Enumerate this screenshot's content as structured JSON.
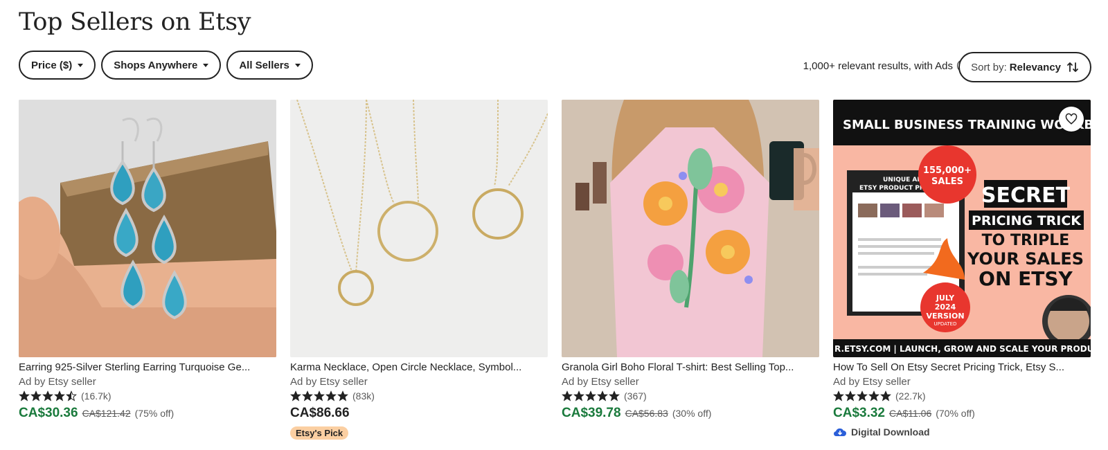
{
  "page": {
    "title": "Top Sellers on Etsy"
  },
  "filters": [
    {
      "label": "Price ($)"
    },
    {
      "label": "Shops Anywhere"
    },
    {
      "label": "All Sellers"
    }
  ],
  "results": {
    "text": "1,000+ relevant results, with Ads",
    "help_icon": "?"
  },
  "sort": {
    "label": "Sort by:",
    "value": "Relevancy"
  },
  "colors": {
    "sale_price": "#1a7a3c",
    "etsys_pick_badge": "#fbcfa2",
    "text": "#222222",
    "muted": "#595959"
  },
  "products": [
    {
      "title": "Earring 925-Silver Sterling Earring Turquoise Ge...",
      "seller": "Ad by Etsy seller",
      "rating": 4.5,
      "reviews": "(16.7k)",
      "price": "CA$30.36",
      "original_price": "CA$121.42",
      "discount": "(75% off)",
      "image": "turquoise-earrings-image"
    },
    {
      "title": "Karma Necklace, Open Circle Necklace, Symbol...",
      "seller": "Ad by Etsy seller",
      "rating": 5,
      "reviews": "(83k)",
      "price": "CA$86.66",
      "badge": "Etsy's Pick",
      "image": "gold-circle-necklace-image"
    },
    {
      "title": "Granola Girl Boho Floral T-shirt: Best Selling Top...",
      "seller": "Ad by Etsy seller",
      "rating": 5,
      "reviews": "(367)",
      "price": "CA$39.78",
      "original_price": "CA$56.83",
      "discount": "(30% off)",
      "image": "floral-tshirt-image"
    },
    {
      "title": "How To Sell On Etsy Secret Pricing Trick, Etsy S...",
      "seller": "Ad by Etsy seller",
      "rating": 5,
      "reviews": "(22.7k)",
      "price": "CA$3.32",
      "original_price": "CA$11.06",
      "discount": "(70% off)",
      "digital_label": "Digital Download",
      "image": "pricing-workbook-image",
      "image_text": {
        "header": "SMALL BUSINESS TRAINING WORKBOOK",
        "sales_badge_line1": "155,000+",
        "sales_badge_line2": "SALES",
        "headline_1": "SECRET",
        "headline_2": "PRICING TRICK",
        "headline_3": "TO TRIPLE",
        "headline_4": "YOUR SALES",
        "headline_5": "ON ETSY",
        "version_line1": "JULY",
        "version_line2": "2024",
        "version_line3": "VERSION",
        "version_line4": "UPDATED",
        "doc_line1": "UNIQUE AND SECR",
        "doc_line2": "ETSY PRODUCT PRICING",
        "footer": "R.ETSY.COM | LAUNCH, GROW AND SCALE YOUR PRODUC"
      }
    }
  ]
}
